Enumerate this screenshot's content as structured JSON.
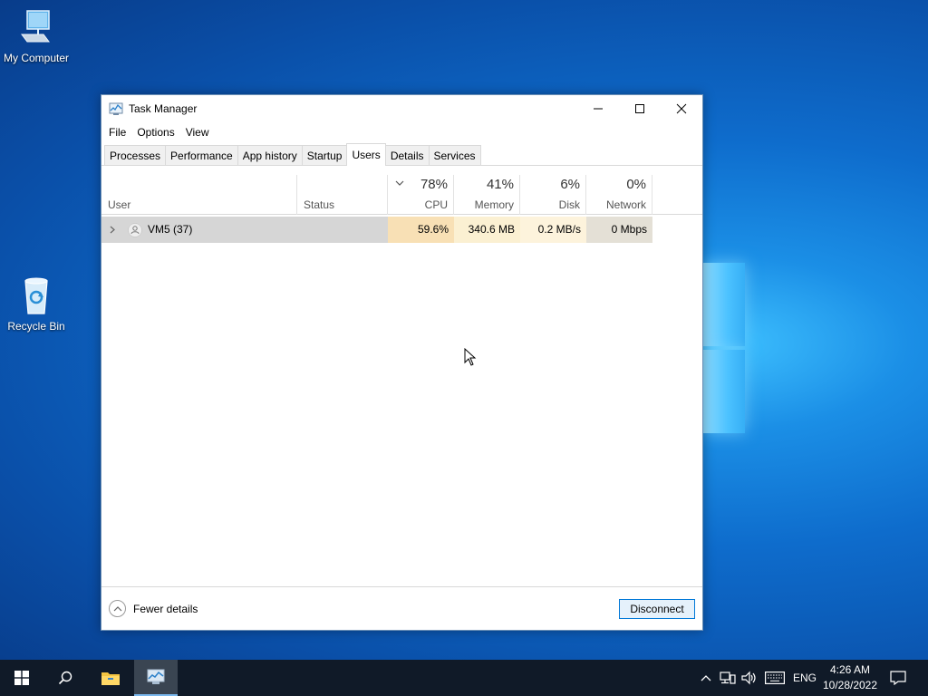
{
  "desktop": {
    "icons": [
      {
        "label": "My Computer"
      },
      {
        "label": "Recycle Bin"
      }
    ]
  },
  "window": {
    "title": "Task Manager",
    "menu": [
      "File",
      "Options",
      "View"
    ],
    "tabs": [
      "Processes",
      "Performance",
      "App history",
      "Startup",
      "Users",
      "Details",
      "Services"
    ],
    "active_tab": "Users",
    "columns": {
      "user": "User",
      "status": "Status",
      "cpu": {
        "label": "CPU",
        "pct": "78%"
      },
      "memory": {
        "label": "Memory",
        "pct": "41%"
      },
      "disk": {
        "label": "Disk",
        "pct": "6%"
      },
      "network": {
        "label": "Network",
        "pct": "0%"
      }
    },
    "rows": [
      {
        "user": "VM5 (37)",
        "status": "",
        "cpu": "59.6%",
        "memory": "340.6 MB",
        "disk": "0.2 MB/s",
        "network": "0 Mbps"
      }
    ],
    "footer": {
      "fewer_details": "Fewer details",
      "disconnect": "Disconnect"
    }
  },
  "taskbar": {
    "language": "ENG",
    "time": "4:26 AM",
    "date": "10/28/2022"
  },
  "colors": {
    "cpu_heat": "#f8e0b5",
    "memory_heat": "#fbf0d2",
    "disk_heat": "#fdf6e4",
    "network_heat": "#fdfaf2",
    "accent": "#0078d7"
  }
}
